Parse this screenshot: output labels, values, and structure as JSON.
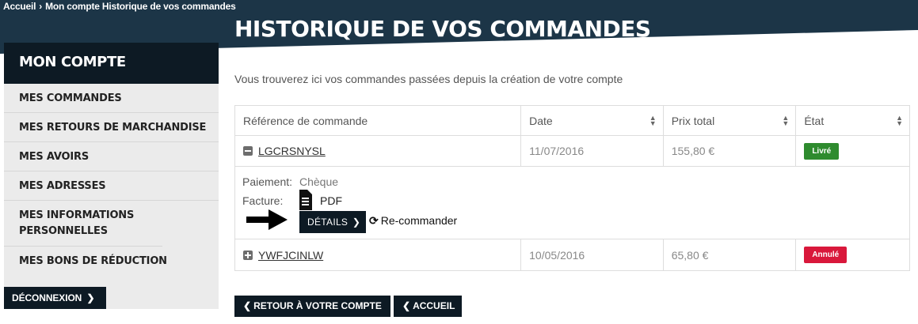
{
  "breadcrumb": {
    "home": "Accueil",
    "separator": "›",
    "current": "Mon compte Historique de vos commandes"
  },
  "page_title": "HISTORIQUE DE VOS COMMANDES",
  "sidebar": {
    "title": "MON COMPTE",
    "items": [
      {
        "label": "MES COMMANDES"
      },
      {
        "label": "MES RETOURS DE MARCHANDISE"
      },
      {
        "label": "MES AVOIRS"
      },
      {
        "label": "MES ADRESSES"
      },
      {
        "label": "MES INFORMATIONS PERSONNELLES"
      },
      {
        "label": "MES BONS DE RÉDUCTION"
      }
    ],
    "logout": "DÉCONNEXION"
  },
  "intro": "Vous trouverez ici vos commandes passées depuis la création de votre compte",
  "orders_table": {
    "headers": [
      "Référence de commande",
      "Date",
      "Prix total",
      "État"
    ],
    "rows": [
      {
        "reference": "LGCRSNYSL",
        "date": "11/07/2016",
        "total": "155,80 €",
        "status": "Livré",
        "status_color": "#2e8b2e",
        "expanded": true
      },
      {
        "reference": "YWFJCINLW",
        "date": "10/05/2016",
        "total": "65,80 €",
        "status": "Annulé",
        "status_color": "#d9183b",
        "expanded": false
      }
    ],
    "details": {
      "payment_label": "Paiement:",
      "payment_value": "Chèque",
      "invoice_label": "Facture:",
      "invoice_link": "PDF",
      "details_button": "DÉTAILS",
      "reorder_link": "Re-commander"
    }
  },
  "actions": {
    "back_account": "RETOUR À VOTRE COMPTE",
    "home": "ACCUEIL"
  },
  "colors": {
    "navy": "#0d1a24",
    "header_band": "#1c3547",
    "delivered": "#2e8b2e",
    "cancelled": "#d9183b"
  }
}
